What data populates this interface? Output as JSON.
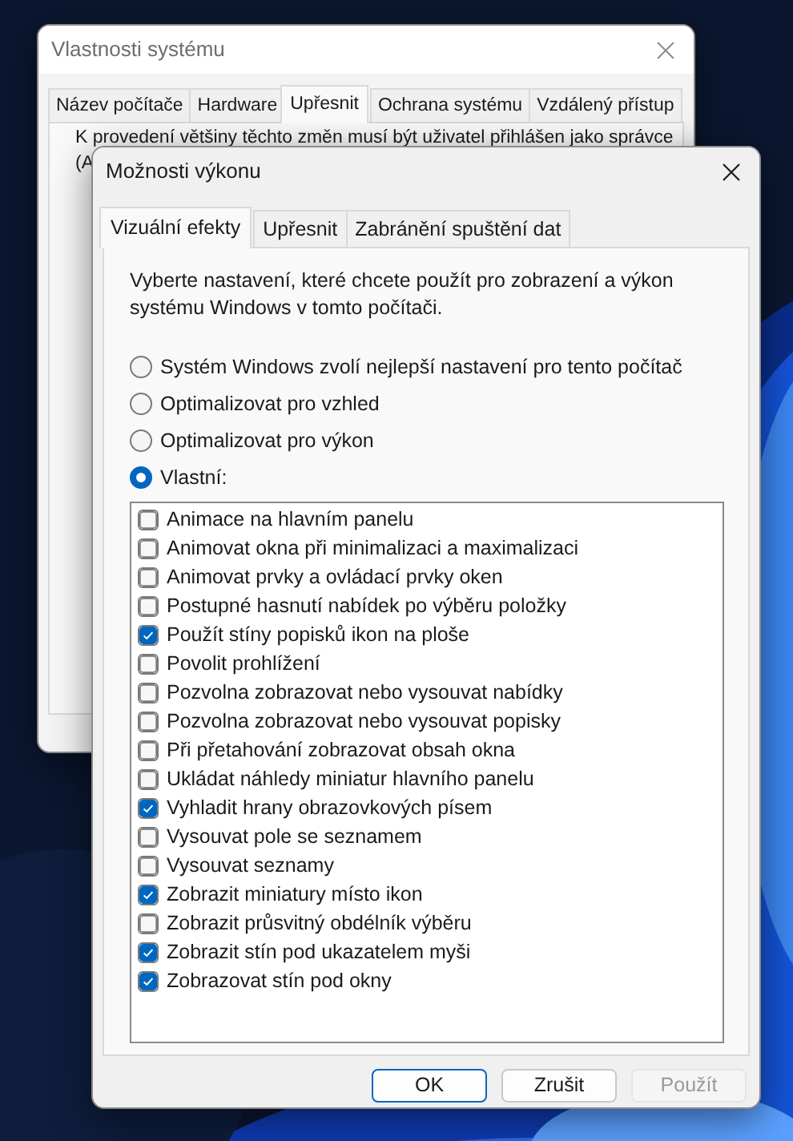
{
  "background_window": {
    "title": "Vlastnosti systému",
    "tabs": [
      {
        "label": "Název počítače",
        "selected": false
      },
      {
        "label": "Hardware",
        "selected": false
      },
      {
        "label": "Upřesnit",
        "selected": true
      },
      {
        "label": "Ochrana systému",
        "selected": false
      },
      {
        "label": "Vzdálený přístup",
        "selected": false
      }
    ],
    "notice": "K provedení většiny těchto změn musí být uživatel přihlášen jako správce",
    "notice_cut": "(A"
  },
  "dialog": {
    "title": "Možnosti výkonu",
    "tabs": [
      {
        "label": "Vizuální efekty",
        "selected": true
      },
      {
        "label": "Upřesnit",
        "selected": false
      },
      {
        "label": "Zabránění spuštění dat",
        "selected": false
      }
    ],
    "description": "Vyberte nastavení, které chcete použít pro zobrazení a výkon systému Windows v tomto počítači.",
    "radios": [
      {
        "label": "Systém Windows zvolí nejlepší nastavení pro tento počítač",
        "selected": false
      },
      {
        "label": "Optimalizovat pro vzhled",
        "selected": false
      },
      {
        "label": "Optimalizovat pro výkon",
        "selected": false
      },
      {
        "label": "Vlastní:",
        "selected": true
      }
    ],
    "options": [
      {
        "label": "Animace na hlavním panelu",
        "checked": false
      },
      {
        "label": "Animovat okna při minimalizaci a maximalizaci",
        "checked": false
      },
      {
        "label": "Animovat prvky a ovládací prvky oken",
        "checked": false
      },
      {
        "label": "Postupné hasnutí nabídek po výběru položky",
        "checked": false
      },
      {
        "label": "Použít stíny popisků ikon na ploše",
        "checked": true
      },
      {
        "label": "Povolit prohlížení",
        "checked": false
      },
      {
        "label": "Pozvolna zobrazovat nebo vysouvat nabídky",
        "checked": false
      },
      {
        "label": "Pozvolna zobrazovat nebo vysouvat popisky",
        "checked": false
      },
      {
        "label": "Při přetahování zobrazovat obsah okna",
        "checked": false
      },
      {
        "label": "Ukládat náhledy miniatur hlavního panelu",
        "checked": false
      },
      {
        "label": "Vyhladit hrany obrazovkových písem",
        "checked": true
      },
      {
        "label": "Vysouvat pole se seznamem",
        "checked": false
      },
      {
        "label": "Vysouvat seznamy",
        "checked": false
      },
      {
        "label": "Zobrazit miniatury místo ikon",
        "checked": true
      },
      {
        "label": "Zobrazit průsvitný obdélník výběru",
        "checked": false
      },
      {
        "label": "Zobrazit stín pod ukazatelem myši",
        "checked": true
      },
      {
        "label": "Zobrazovat stín pod okny",
        "checked": true
      }
    ],
    "buttons": [
      {
        "label": "OK",
        "default": true,
        "disabled": false
      },
      {
        "label": "Zrušit",
        "default": false,
        "disabled": false
      },
      {
        "label": "Použít",
        "default": false,
        "disabled": true
      }
    ]
  }
}
